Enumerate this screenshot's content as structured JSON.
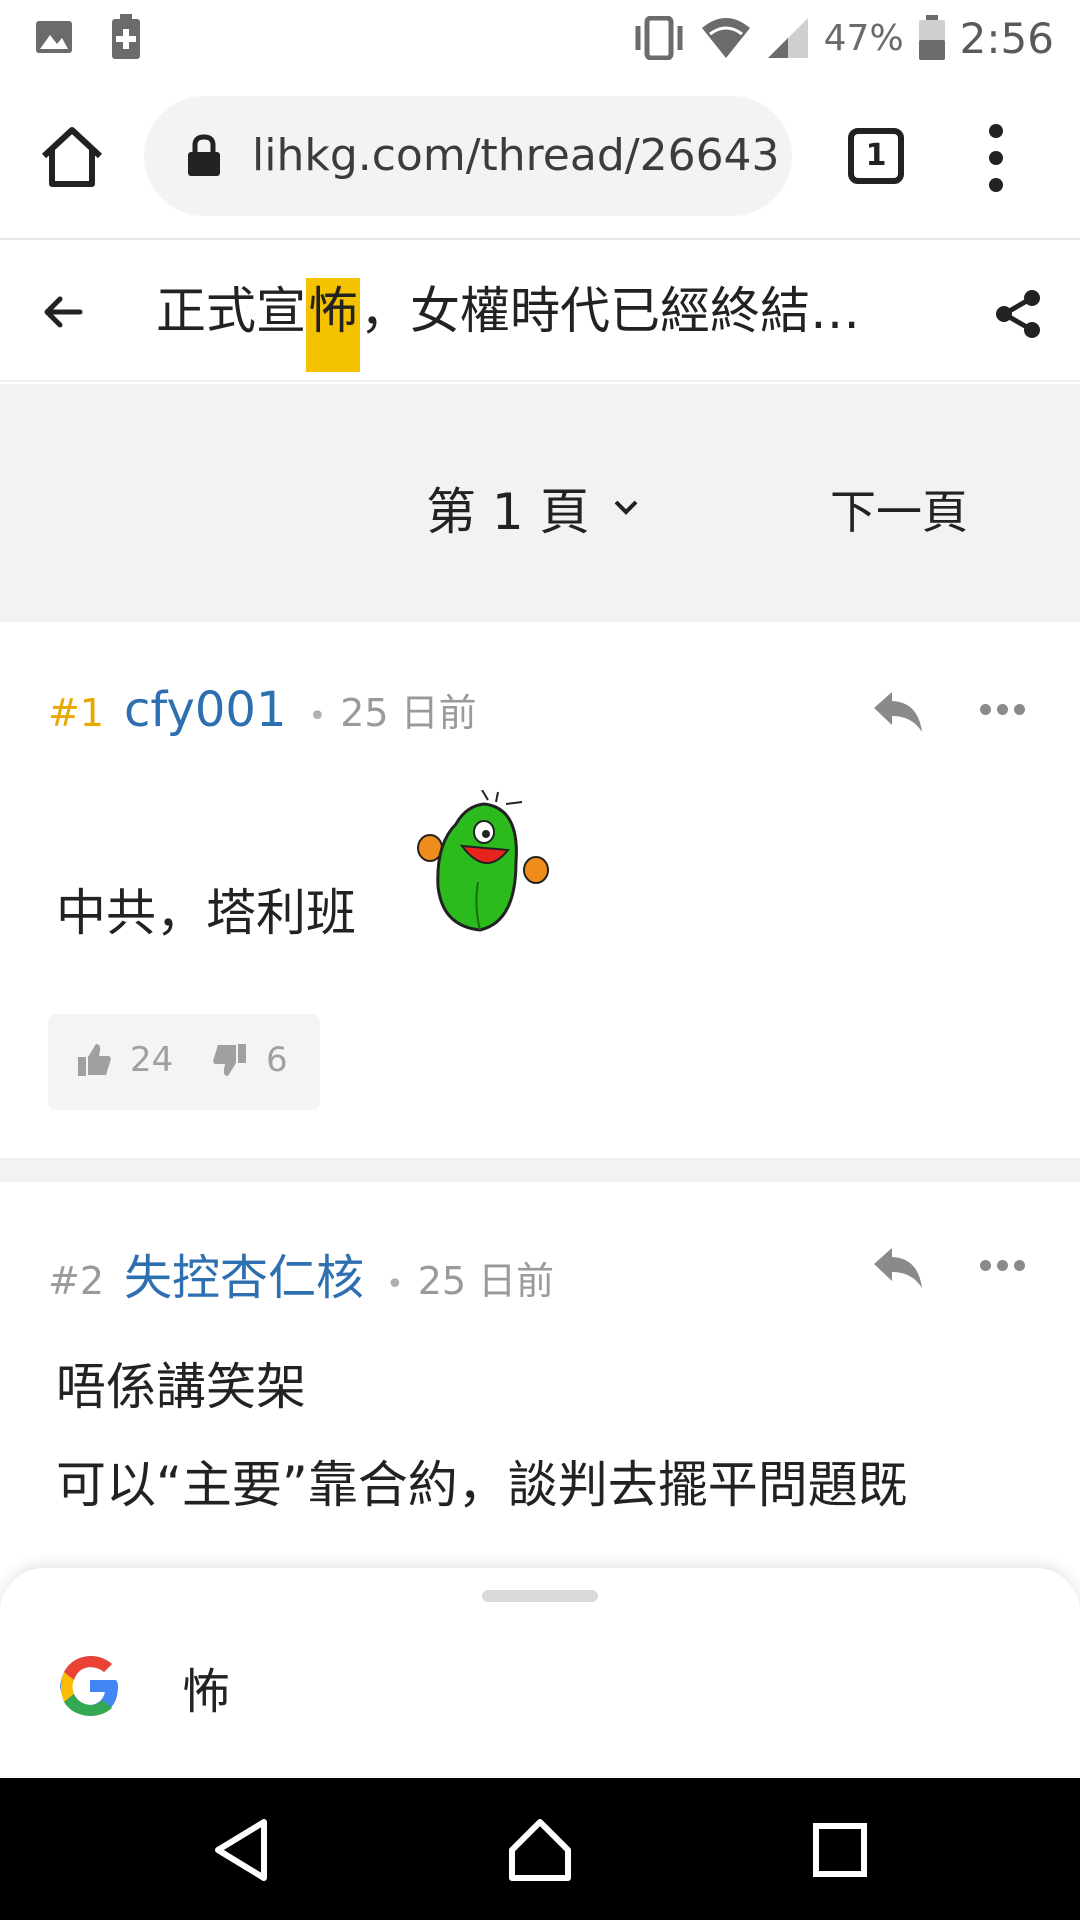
{
  "status_bar": {
    "battery_percent": "47%",
    "time": "2:56",
    "icons": [
      "image-icon",
      "battery-saver-icon",
      "vibrate-icon",
      "wifi-icon",
      "signal-icon",
      "battery-icon"
    ]
  },
  "browser": {
    "url": "lihkg.com/thread/26643",
    "tab_count": "1"
  },
  "thread": {
    "title_before": "正式宣",
    "title_highlight": "怖",
    "title_after": "，女權時代已經終結…",
    "highlight_color": "#f5c200"
  },
  "pager": {
    "current_page": "第 1 頁",
    "next_label": "下一頁"
  },
  "posts": [
    {
      "floor": "#1",
      "author": "cfy001",
      "time": "25 日前",
      "body": "中共，塔利班",
      "likes": "24",
      "dislikes": "6",
      "sticker": "green-pear-sticker"
    },
    {
      "floor": "#2",
      "author": "失控杏仁核",
      "time": "25 日前",
      "body_lines": [
        "唔係講笑架",
        "可以“主要”靠合約，談判去擺平問題既"
      ]
    }
  ],
  "search_sheet": {
    "query": "怖"
  },
  "colors": {
    "floor1": "#e8a800",
    "author": "#2d6fb0",
    "highlight": "#f5c200"
  }
}
